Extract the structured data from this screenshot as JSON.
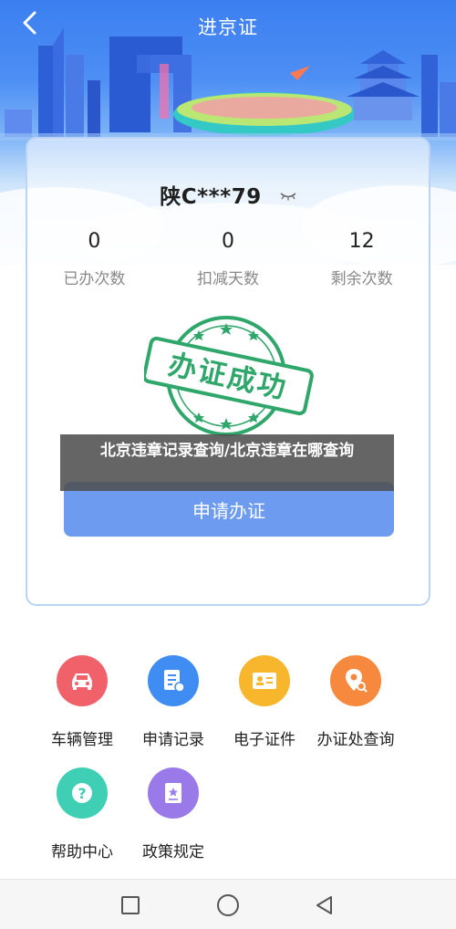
{
  "header": {
    "title": "进京证",
    "back_icon": "chevron-left-icon"
  },
  "card": {
    "plate": "陕C***79",
    "eye_icon": "eye-closed-icon",
    "stats": [
      {
        "value": "0",
        "label": "已办次数"
      },
      {
        "value": "0",
        "label": "扣减天数"
      },
      {
        "value": "12",
        "label": "剩余次数"
      }
    ],
    "stamp_text": "办证成功",
    "apply_button": "申请办证"
  },
  "overlay_caption": "北京违章记录查询/北京违章在哪查询",
  "features": [
    {
      "label": "车辆管理",
      "icon": "car-icon",
      "color": "#f0616a"
    },
    {
      "label": "申请记录",
      "icon": "record-icon",
      "color": "#3f8cf2"
    },
    {
      "label": "电子证件",
      "icon": "id-card-icon",
      "color": "#f8b62d"
    },
    {
      "label": "办证处查询",
      "icon": "location-search-icon",
      "color": "#f7893f"
    },
    {
      "label": "帮助中心",
      "icon": "help-icon",
      "color": "#3ecfb4"
    },
    {
      "label": "政策规定",
      "icon": "policy-book-icon",
      "color": "#9a7ae8"
    }
  ],
  "system_nav": {
    "recents_icon": "square-icon",
    "home_icon": "circle-icon",
    "back_icon": "triangle-back-icon"
  },
  "colors": {
    "primary": "#6c9bf0",
    "stamp_green": "#2fa66a",
    "card_border": "#b9d4f7"
  }
}
